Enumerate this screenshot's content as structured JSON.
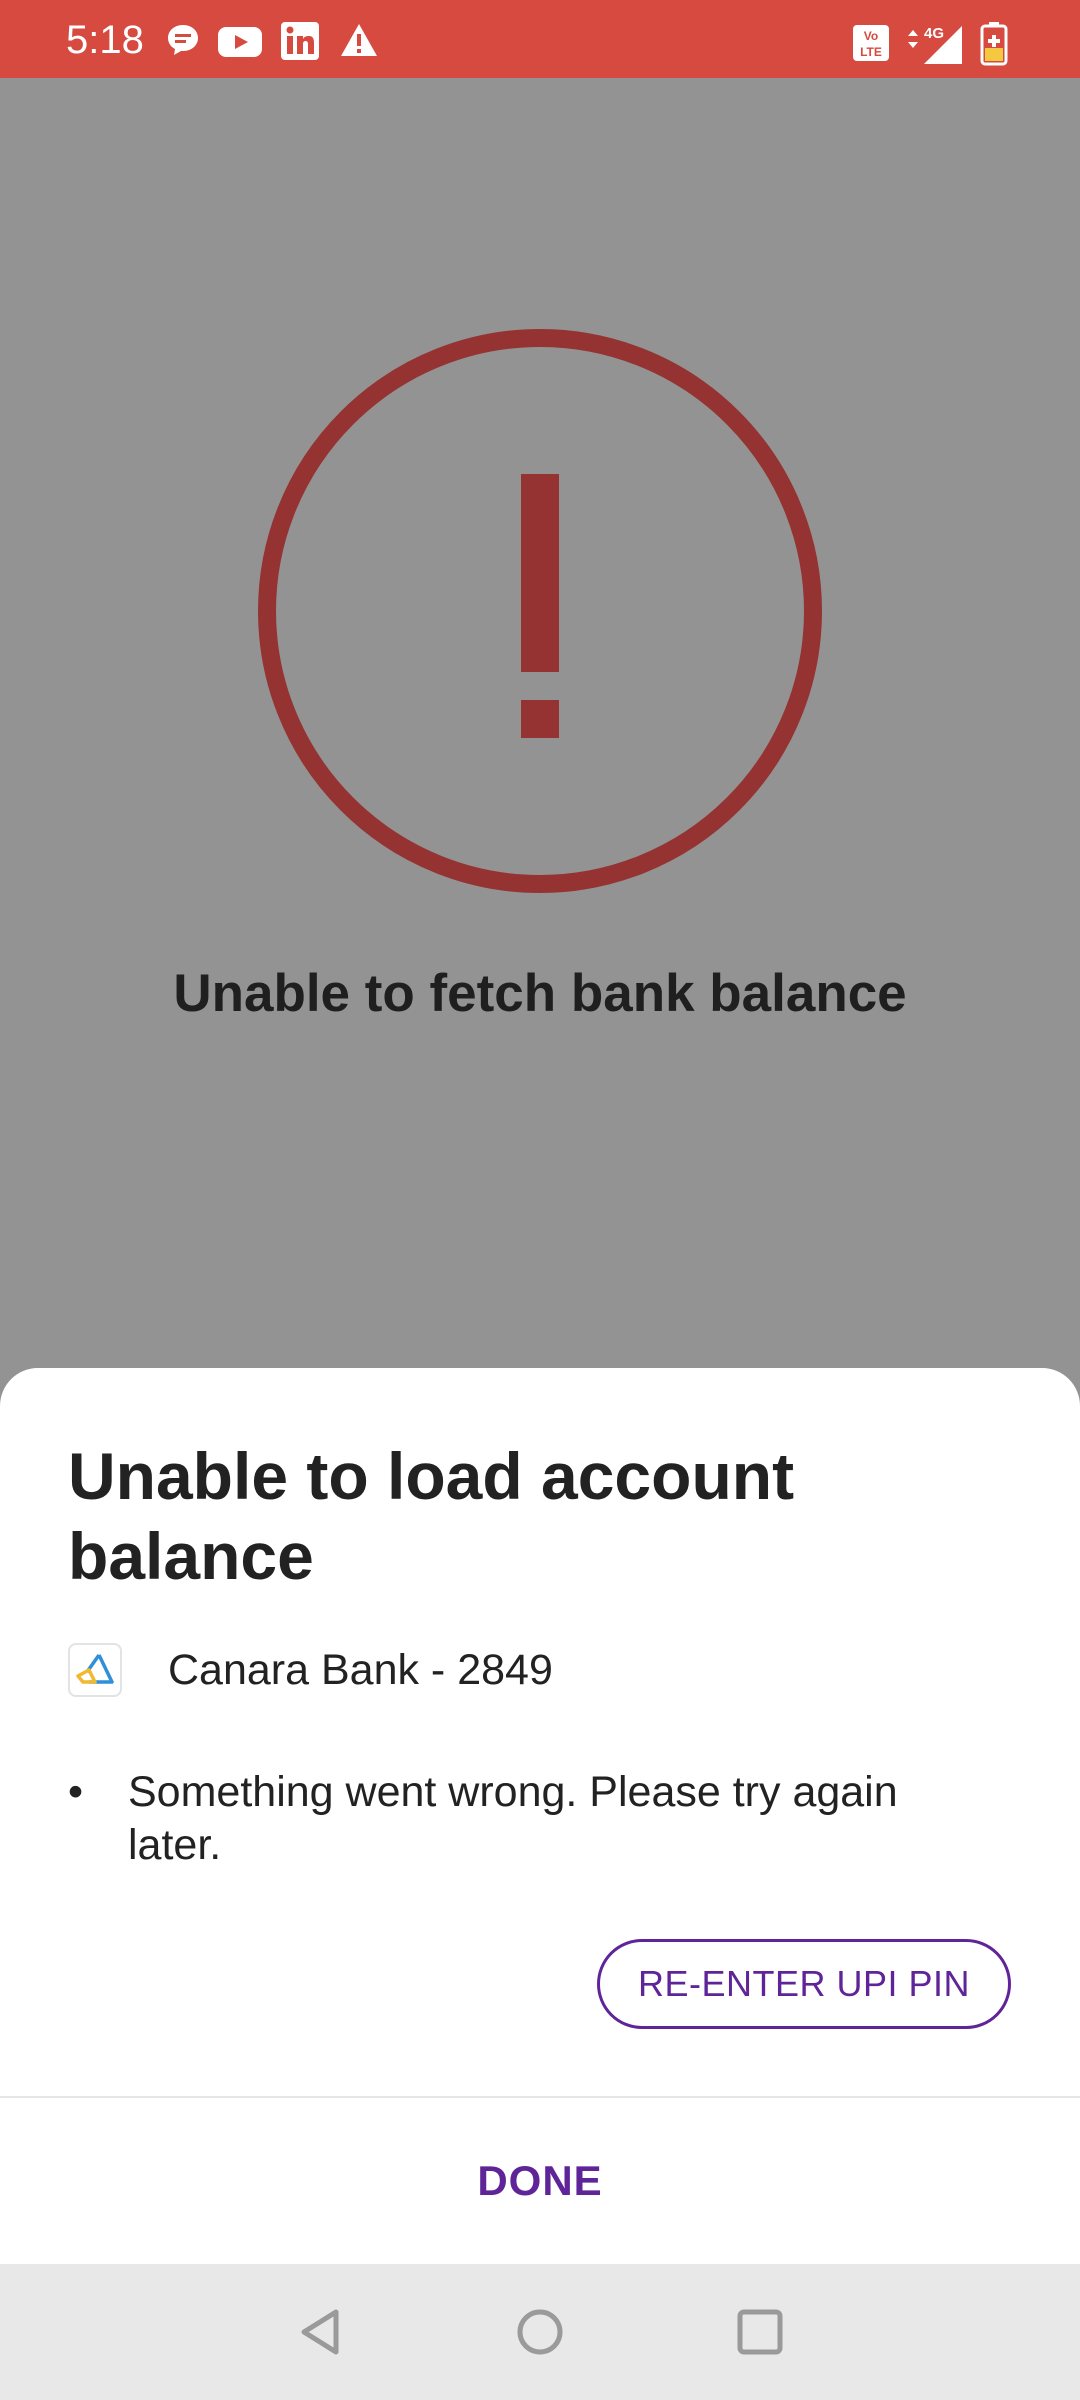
{
  "status_bar": {
    "time": "5:18",
    "left_icons": [
      "chat-bubble-icon",
      "youtube-icon",
      "linkedin-icon",
      "warning-icon"
    ],
    "right_icons": [
      "volte-icon",
      "4g-signal-icon",
      "battery-charging-icon"
    ],
    "network_label": "4G",
    "volte_label": "Vo LTE",
    "color": "#d64a40"
  },
  "background": {
    "error_icon": "exclamation-circle-icon",
    "error_color": "#943331",
    "title": "Unable to fetch bank balance"
  },
  "sheet": {
    "title": "Unable to load account balance",
    "bank": {
      "logo_icon": "canara-bank-logo",
      "name": "Canara Bank - 2849"
    },
    "messages": [
      "Something went wrong. Please try again later."
    ],
    "reenter_button": "RE-ENTER UPI PIN",
    "done_button": "DONE",
    "accent_color": "#5f2598"
  },
  "nav_bar": {
    "buttons": [
      "back-icon",
      "home-icon",
      "recents-icon"
    ]
  }
}
